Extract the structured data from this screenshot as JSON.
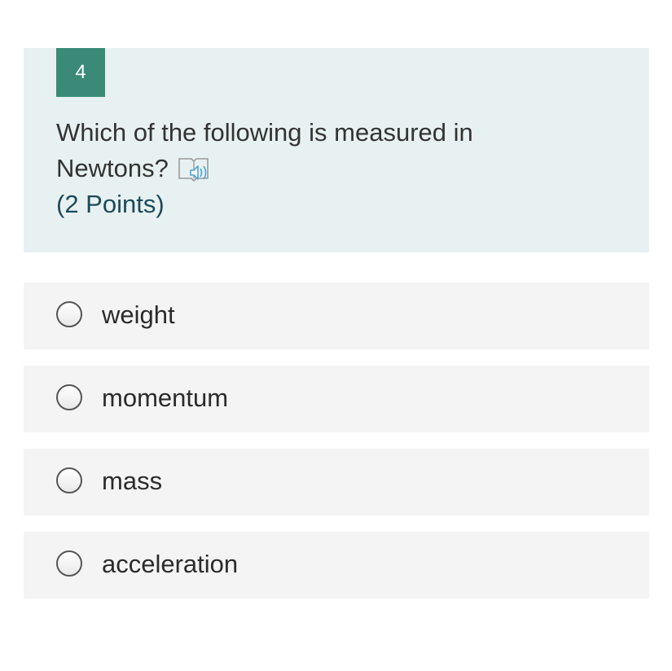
{
  "question": {
    "number": "4",
    "line1": "Which of the following is measured in",
    "line2": "Newtons?",
    "points": "(2 Points)",
    "reader_icon": "immersive-reader-icon"
  },
  "options": [
    {
      "label": "weight",
      "selected": false
    },
    {
      "label": "momentum",
      "selected": false
    },
    {
      "label": "mass",
      "selected": false
    },
    {
      "label": "acceleration",
      "selected": false
    }
  ],
  "colors": {
    "badge": "#3a8a77",
    "question_bg": "#e8f1f2",
    "option_bg": "#f4f4f4",
    "points_text": "#1d4a5a",
    "reader_icon": "#4aa3d8"
  }
}
